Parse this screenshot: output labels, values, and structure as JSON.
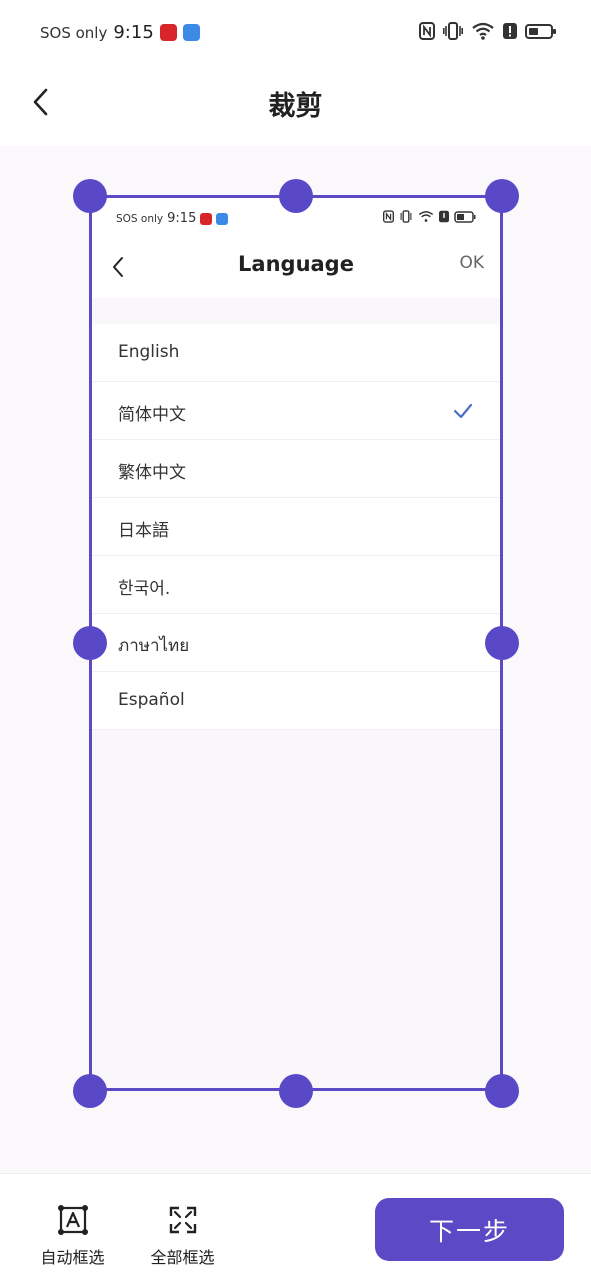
{
  "status_bar": {
    "carrier": "SOS only",
    "time": "9:15",
    "battery_level": 0.45
  },
  "header": {
    "title": "裁剪"
  },
  "inner_screenshot": {
    "status_bar": {
      "carrier": "SOS only",
      "time": "9:15"
    },
    "header": {
      "title": "Language",
      "ok_label": "OK"
    },
    "languages": [
      {
        "label": "English",
        "selected": false
      },
      {
        "label": "简体中文",
        "selected": true
      },
      {
        "label": "繁体中文",
        "selected": false
      },
      {
        "label": "日本語",
        "selected": false
      },
      {
        "label": "한국어.",
        "selected": false
      },
      {
        "label": "ภาษาไทย",
        "selected": false
      },
      {
        "label": "Español",
        "selected": false
      }
    ]
  },
  "toolbar": {
    "auto_select_label": "自动框选",
    "select_all_label": "全部框选",
    "next_label": "下一步"
  },
  "colors": {
    "accent": "#5b49c6",
    "check": "#4a6fc4",
    "canvas_bg": "#fbf8fb"
  },
  "icons": [
    "back-arrow-icon",
    "nfc-icon",
    "vibrate-icon",
    "wifi-icon",
    "alert-icon",
    "battery-icon",
    "checkmark-icon",
    "auto-select-icon",
    "select-all-icon"
  ]
}
